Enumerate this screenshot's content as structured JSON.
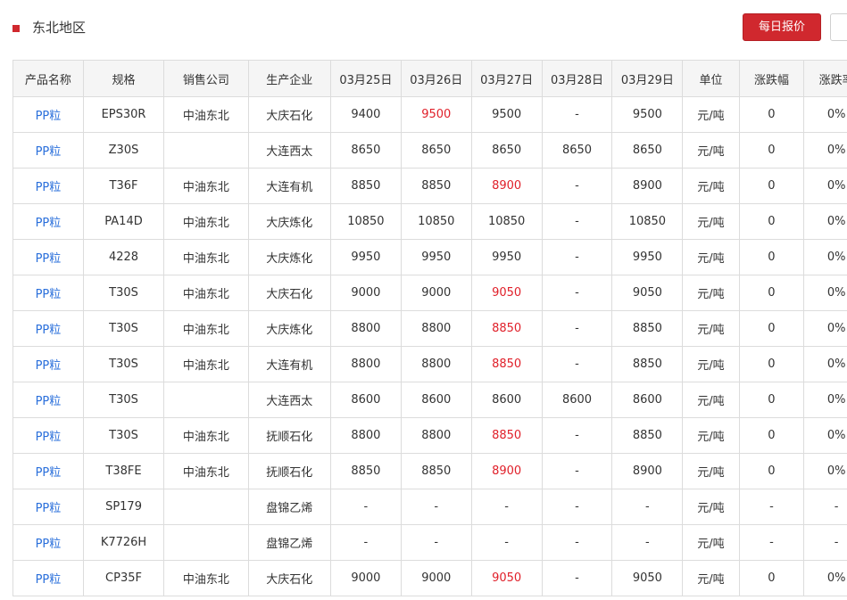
{
  "header": {
    "title": "东北地区",
    "quote_button": "每日报价"
  },
  "table": {
    "columns": [
      "产品名称",
      "规格",
      "销售公司",
      "生产企业",
      "03月25日",
      "03月26日",
      "03月27日",
      "03月28日",
      "03月29日",
      "单位",
      "涨跌幅",
      "涨跌率"
    ],
    "rows": [
      {
        "product": "PP粒",
        "spec": "EPS30R",
        "seller": "中油东北",
        "producer": "大庆石化",
        "d1": "9400",
        "d2": "9500",
        "d3": "9500",
        "d4": "-",
        "d5": "9500",
        "unit": "元/吨",
        "change": "0",
        "rate": "0%",
        "up": [
          "d2"
        ]
      },
      {
        "product": "PP粒",
        "spec": "Z30S",
        "seller": "",
        "producer": "大连西太",
        "d1": "8650",
        "d2": "8650",
        "d3": "8650",
        "d4": "8650",
        "d5": "8650",
        "unit": "元/吨",
        "change": "0",
        "rate": "0%",
        "up": []
      },
      {
        "product": "PP粒",
        "spec": "T36F",
        "seller": "中油东北",
        "producer": "大连有机",
        "d1": "8850",
        "d2": "8850",
        "d3": "8900",
        "d4": "-",
        "d5": "8900",
        "unit": "元/吨",
        "change": "0",
        "rate": "0%",
        "up": [
          "d3"
        ]
      },
      {
        "product": "PP粒",
        "spec": "PA14D",
        "seller": "中油东北",
        "producer": "大庆炼化",
        "d1": "10850",
        "d2": "10850",
        "d3": "10850",
        "d4": "-",
        "d5": "10850",
        "unit": "元/吨",
        "change": "0",
        "rate": "0%",
        "up": []
      },
      {
        "product": "PP粒",
        "spec": "4228",
        "seller": "中油东北",
        "producer": "大庆炼化",
        "d1": "9950",
        "d2": "9950",
        "d3": "9950",
        "d4": "-",
        "d5": "9950",
        "unit": "元/吨",
        "change": "0",
        "rate": "0%",
        "up": []
      },
      {
        "product": "PP粒",
        "spec": "T30S",
        "seller": "中油东北",
        "producer": "大庆石化",
        "d1": "9000",
        "d2": "9000",
        "d3": "9050",
        "d4": "-",
        "d5": "9050",
        "unit": "元/吨",
        "change": "0",
        "rate": "0%",
        "up": [
          "d3"
        ]
      },
      {
        "product": "PP粒",
        "spec": "T30S",
        "seller": "中油东北",
        "producer": "大庆炼化",
        "d1": "8800",
        "d2": "8800",
        "d3": "8850",
        "d4": "-",
        "d5": "8850",
        "unit": "元/吨",
        "change": "0",
        "rate": "0%",
        "up": [
          "d3"
        ]
      },
      {
        "product": "PP粒",
        "spec": "T30S",
        "seller": "中油东北",
        "producer": "大连有机",
        "d1": "8800",
        "d2": "8800",
        "d3": "8850",
        "d4": "-",
        "d5": "8850",
        "unit": "元/吨",
        "change": "0",
        "rate": "0%",
        "up": [
          "d3"
        ]
      },
      {
        "product": "PP粒",
        "spec": "T30S",
        "seller": "",
        "producer": "大连西太",
        "d1": "8600",
        "d2": "8600",
        "d3": "8600",
        "d4": "8600",
        "d5": "8600",
        "unit": "元/吨",
        "change": "0",
        "rate": "0%",
        "up": []
      },
      {
        "product": "PP粒",
        "spec": "T30S",
        "seller": "中油东北",
        "producer": "抚顺石化",
        "d1": "8800",
        "d2": "8800",
        "d3": "8850",
        "d4": "-",
        "d5": "8850",
        "unit": "元/吨",
        "change": "0",
        "rate": "0%",
        "up": [
          "d3"
        ]
      },
      {
        "product": "PP粒",
        "spec": "T38FE",
        "seller": "中油东北",
        "producer": "抚顺石化",
        "d1": "8850",
        "d2": "8850",
        "d3": "8900",
        "d4": "-",
        "d5": "8900",
        "unit": "元/吨",
        "change": "0",
        "rate": "0%",
        "up": [
          "d3"
        ]
      },
      {
        "product": "PP粒",
        "spec": "SP179",
        "seller": "",
        "producer": "盘锦乙烯",
        "d1": "-",
        "d2": "-",
        "d3": "-",
        "d4": "-",
        "d5": "-",
        "unit": "元/吨",
        "change": "-",
        "rate": "-",
        "up": []
      },
      {
        "product": "PP粒",
        "spec": "K7726H",
        "seller": "",
        "producer": "盘锦乙烯",
        "d1": "-",
        "d2": "-",
        "d3": "-",
        "d4": "-",
        "d5": "-",
        "unit": "元/吨",
        "change": "-",
        "rate": "-",
        "up": []
      },
      {
        "product": "PP粒",
        "spec": "CP35F",
        "seller": "中油东北",
        "producer": "大庆石化",
        "d1": "9000",
        "d2": "9000",
        "d3": "9050",
        "d4": "-",
        "d5": "9050",
        "unit": "元/吨",
        "change": "0",
        "rate": "0%",
        "up": [
          "d3"
        ]
      }
    ]
  },
  "colors": {
    "accent": "#d0282e",
    "link": "#2a6fdb",
    "price_up": "#e0202a",
    "header_bg": "#f5f5f5"
  }
}
